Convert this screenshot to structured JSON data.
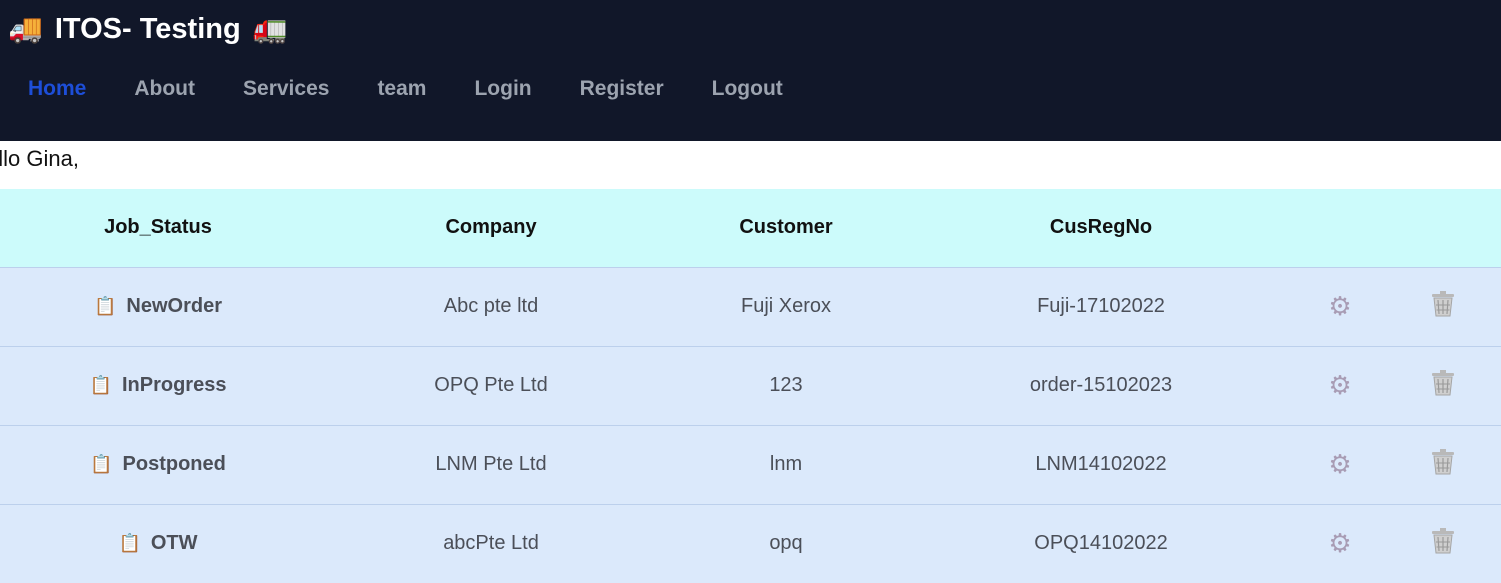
{
  "header": {
    "title": "ITOS- Testing",
    "left_emoji": "🚚",
    "right_emoji": "🚛"
  },
  "nav": {
    "items": [
      "Home",
      "About",
      "Services",
      "team",
      "Login",
      "Register",
      "Logout"
    ],
    "active": "Home"
  },
  "greeting": "ello Gina,",
  "table": {
    "headers": [
      "Job_Status",
      "Company",
      "Customer",
      "CusRegNo",
      "",
      ""
    ],
    "rows": [
      {
        "status": "NewOrder",
        "company": "Abc pte ltd",
        "customer": "Fuji Xerox",
        "regno": "Fuji-17102022"
      },
      {
        "status": "InProgress",
        "company": "OPQ Pte Ltd",
        "customer": "123",
        "regno": "order-15102023"
      },
      {
        "status": "Postponed",
        "company": "LNM Pte Ltd",
        "customer": "lnm",
        "regno": "LNM14102022"
      },
      {
        "status": "OTW",
        "company": "abcPte Ltd",
        "customer": "opq",
        "regno": "OPQ14102022"
      }
    ],
    "row_icons": {
      "status": "clipboard-icon",
      "edit": "gear-icon",
      "delete": "trash-icon"
    }
  },
  "colors": {
    "header_bg": "#111729",
    "nav_active": "#1d4ed8",
    "nav_inactive": "#9ca3af",
    "table_header_bg": "#ccfbfb",
    "row_bg": "#dbe9fb"
  }
}
